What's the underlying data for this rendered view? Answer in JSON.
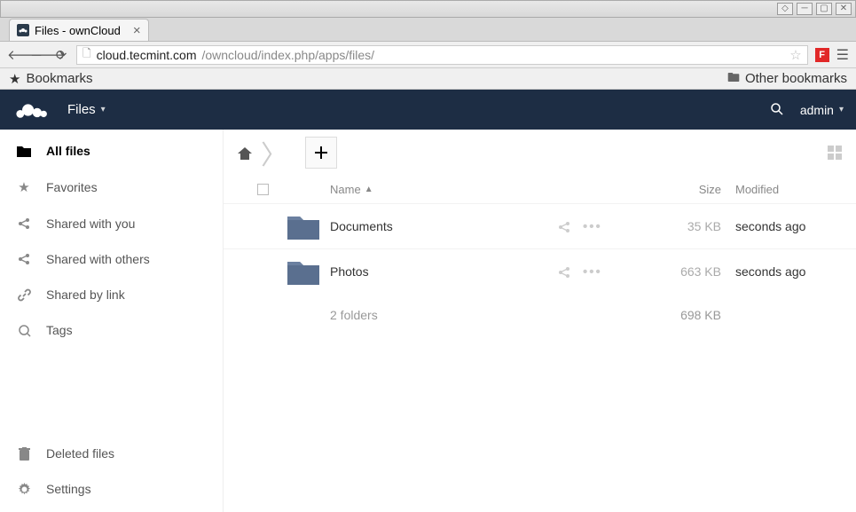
{
  "window": {
    "tab_title": "Files - ownCloud"
  },
  "browser": {
    "url_host": "cloud.tecmint.com",
    "url_path": "/owncloud/index.php/apps/files/",
    "bookmarks_label": "Bookmarks",
    "other_bookmarks_label": "Other bookmarks"
  },
  "topnav": {
    "app_label": "Files",
    "user_label": "admin"
  },
  "sidebar": {
    "items": [
      {
        "label": "All files",
        "icon": "folder-solid",
        "active": true
      },
      {
        "label": "Favorites",
        "icon": "star"
      },
      {
        "label": "Shared with you",
        "icon": "share"
      },
      {
        "label": "Shared with others",
        "icon": "share"
      },
      {
        "label": "Shared by link",
        "icon": "link"
      },
      {
        "label": "Tags",
        "icon": "tag"
      }
    ],
    "bottom": [
      {
        "label": "Deleted files",
        "icon": "trash"
      },
      {
        "label": "Settings",
        "icon": "gear"
      }
    ]
  },
  "files": {
    "columns": {
      "name": "Name",
      "size": "Size",
      "modified": "Modified"
    },
    "rows": [
      {
        "name": "Documents",
        "size": "35 KB",
        "modified": "seconds ago"
      },
      {
        "name": "Photos",
        "size": "663 KB",
        "modified": "seconds ago"
      }
    ],
    "summary": {
      "text": "2 folders",
      "size": "698 KB"
    }
  }
}
